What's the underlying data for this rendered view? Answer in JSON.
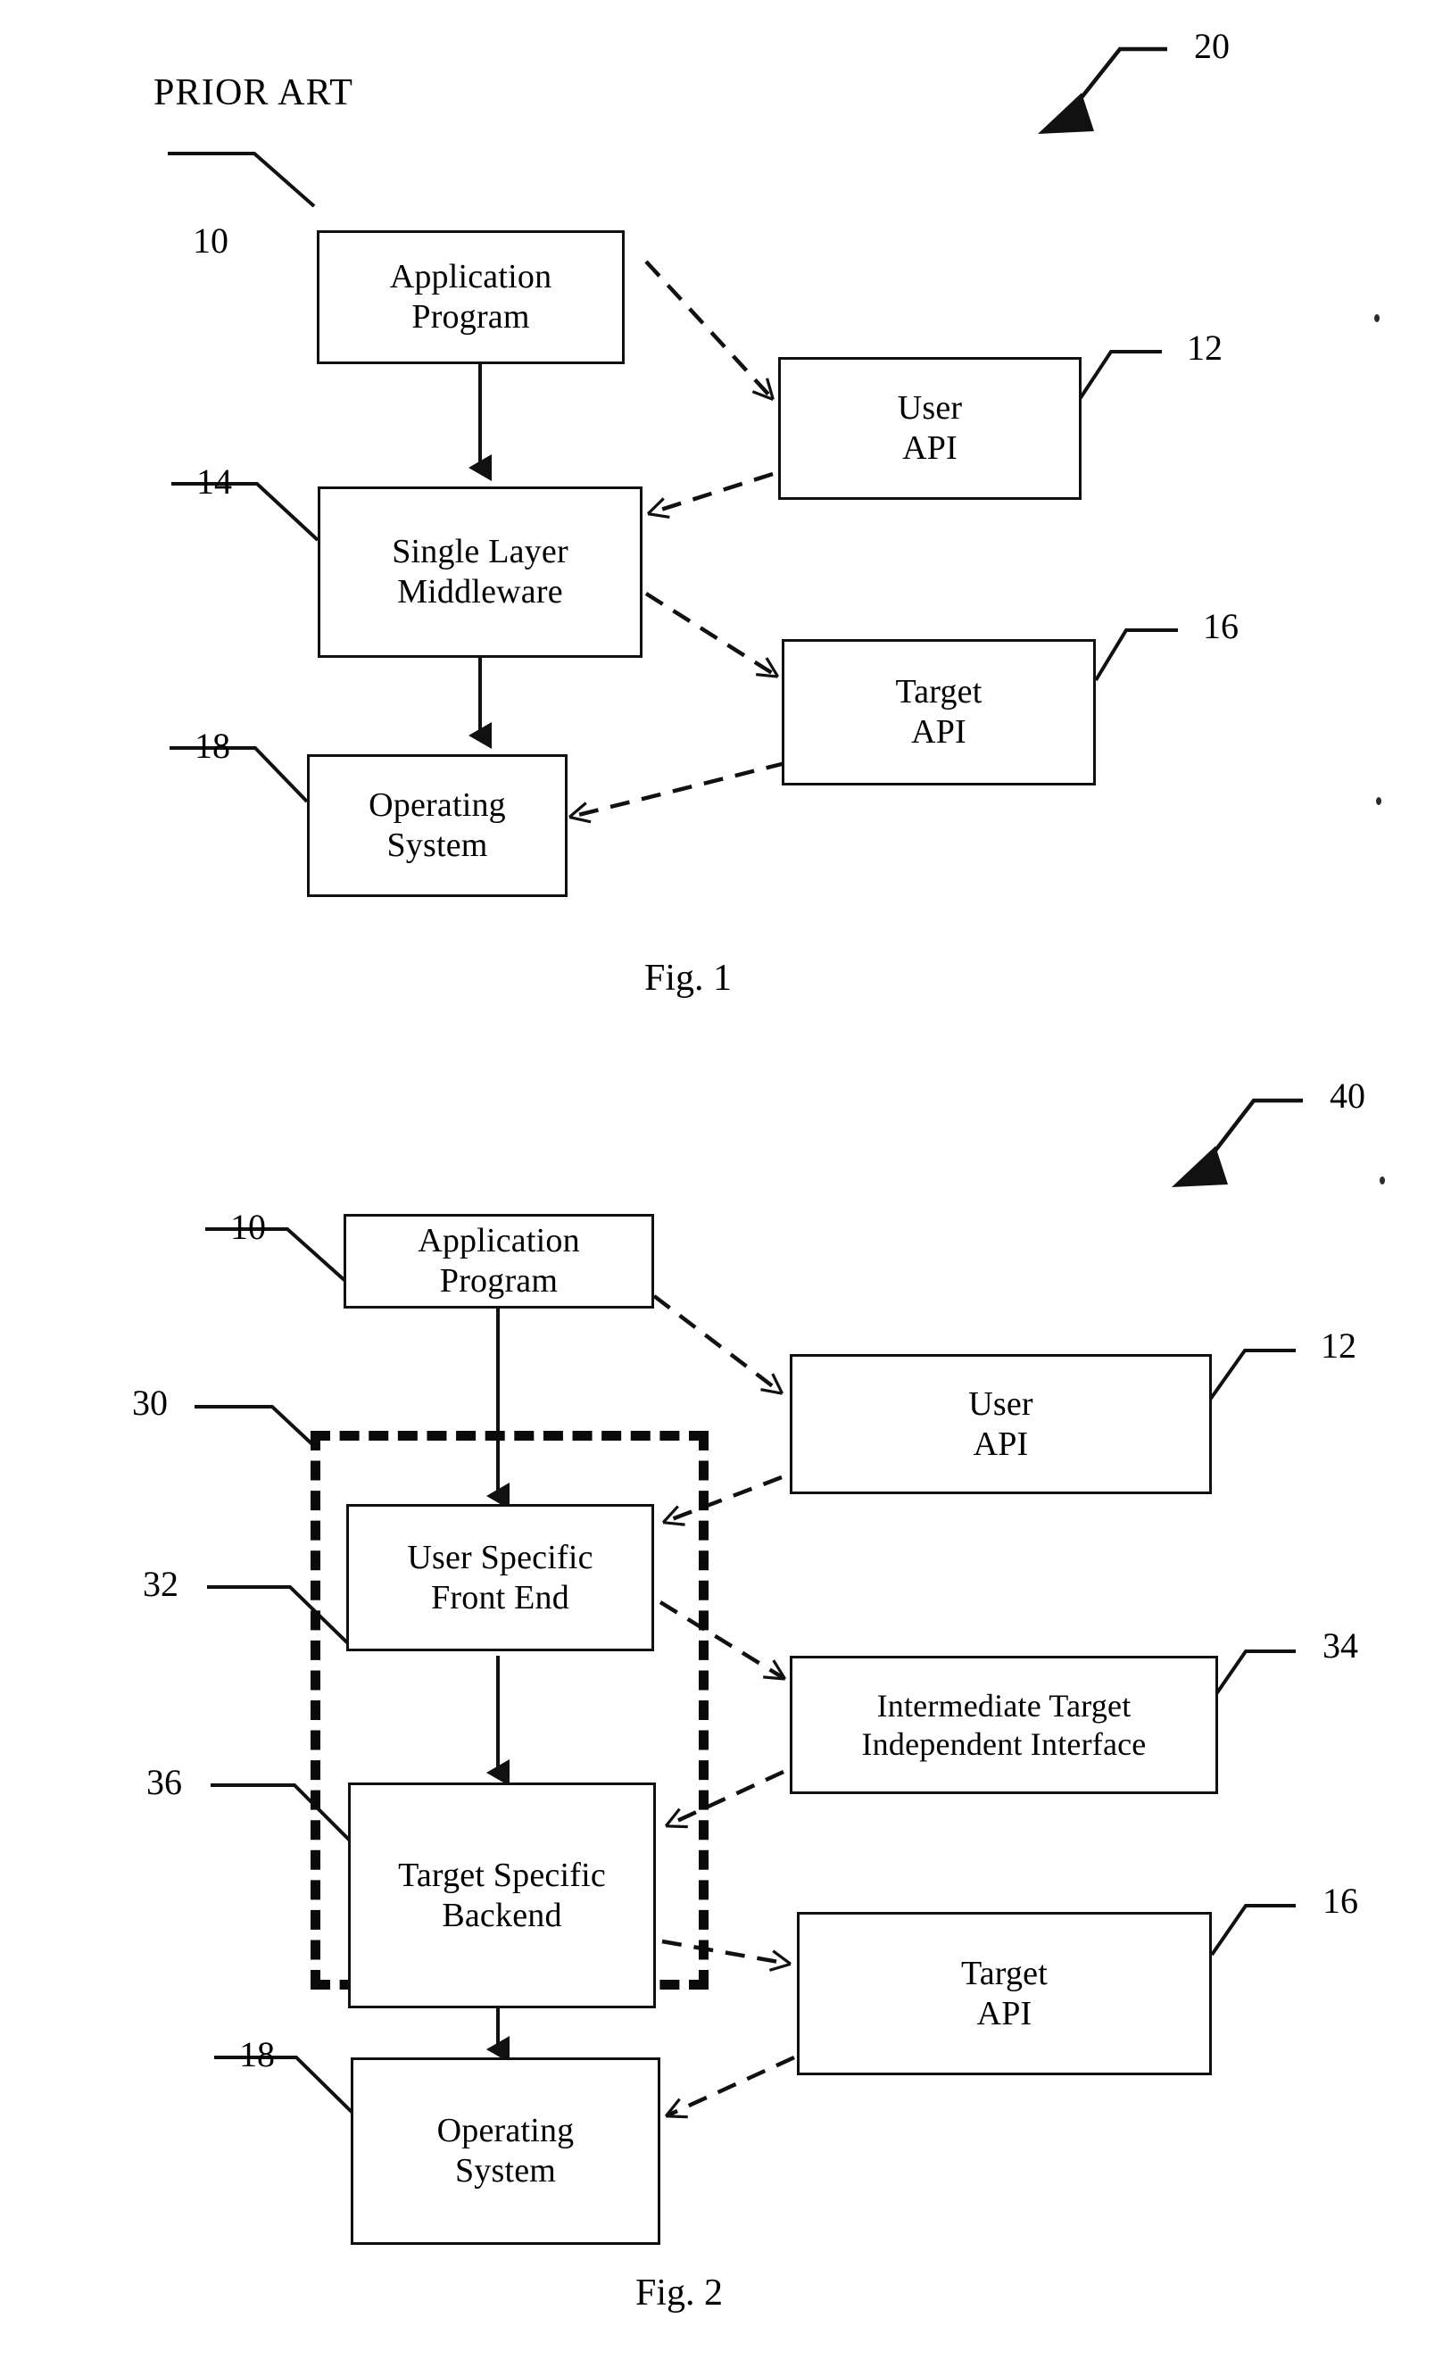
{
  "figures": [
    {
      "id": "fig1",
      "prior_art_label": "PRIOR ART",
      "assembly_ref": "20",
      "caption": "Fig. 1",
      "nodes": {
        "application_program": {
          "line1": "Application",
          "line2": "Program",
          "ref": "10"
        },
        "user_api": {
          "line1": "User",
          "line2": "API",
          "ref": "12"
        },
        "single_layer_middleware": {
          "line1": "Single Layer",
          "line2": "Middleware",
          "ref": "14"
        },
        "target_api": {
          "line1": "Target",
          "line2": "API",
          "ref": "16"
        },
        "operating_system": {
          "line1": "Operating",
          "line2": "System",
          "ref": "18"
        }
      }
    },
    {
      "id": "fig2",
      "assembly_ref": "40",
      "caption": "Fig. 2",
      "boundary_ref": "30",
      "nodes": {
        "application_program": {
          "line1": "Application",
          "line2": "Program",
          "ref": "10"
        },
        "user_api": {
          "line1": "User",
          "line2": "API",
          "ref": "12"
        },
        "user_specific_front_end": {
          "line1": "User Specific",
          "line2": "Front End",
          "ref": "32"
        },
        "intermediate_target_independent_interface": {
          "line1": "Intermediate Target",
          "line2": "Independent Interface",
          "ref": "34"
        },
        "target_specific_backend": {
          "line1": "Target Specific",
          "line2": "Backend",
          "ref": "36"
        },
        "target_api": {
          "line1": "Target",
          "line2": "API",
          "ref": "16"
        },
        "operating_system": {
          "line1": "Operating",
          "line2": "System",
          "ref": "18"
        }
      }
    }
  ]
}
